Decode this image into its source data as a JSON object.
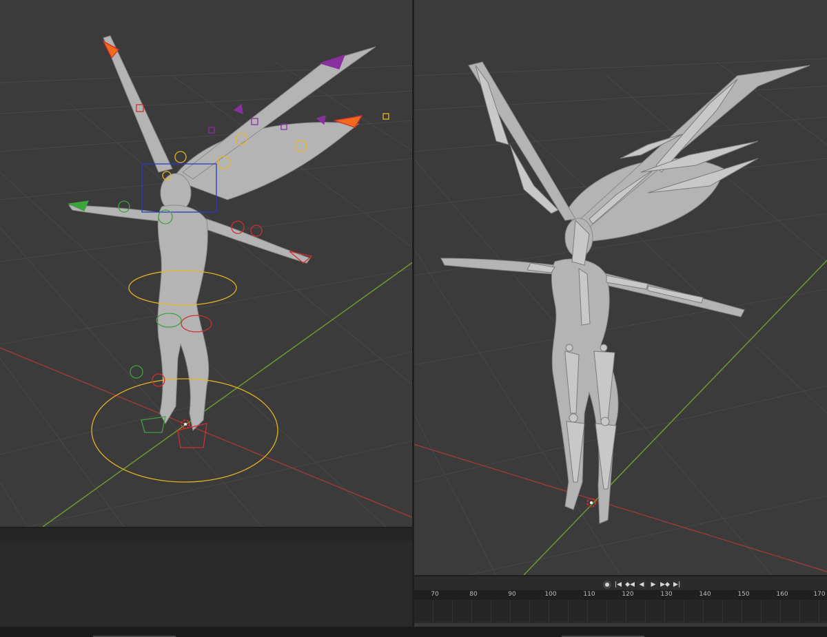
{
  "colors": {
    "viewport_bg": "#3b3b3b",
    "grid_line": "#474747",
    "x_axis": "#9a3a3a",
    "y_axis": "#6e9a2e",
    "mesh": "#b4b4b4",
    "control_yellow": "#e6b422",
    "control_red": "#d22e2e",
    "control_green": "#3da33d",
    "control_purple": "#8a2fa0",
    "control_blue": "#2b3bc8",
    "control_orange": "#f06a1c"
  },
  "left_viewport": {
    "description_icons": [
      "armature-controls-icon",
      "3d-cursor-icon"
    ]
  },
  "right_viewport": {
    "description_icons": [
      "armature-bones-icon",
      "3d-cursor-icon"
    ]
  },
  "timeline": {
    "controls": [
      {
        "name": "keyframe-record-icon",
        "glyph": ""
      },
      {
        "name": "jump-start-icon",
        "glyph": "|◀"
      },
      {
        "name": "prev-keyframe-icon",
        "glyph": "◆◀"
      },
      {
        "name": "play-reverse-icon",
        "glyph": "◀"
      },
      {
        "name": "play-icon",
        "glyph": "▶"
      },
      {
        "name": "next-keyframe-icon",
        "glyph": "▶◆"
      },
      {
        "name": "jump-end-icon",
        "glyph": "▶|"
      }
    ],
    "frame_labels": [
      "70",
      "80",
      "90",
      "100",
      "110",
      "120",
      "130",
      "140",
      "150",
      "160",
      "170"
    ]
  }
}
